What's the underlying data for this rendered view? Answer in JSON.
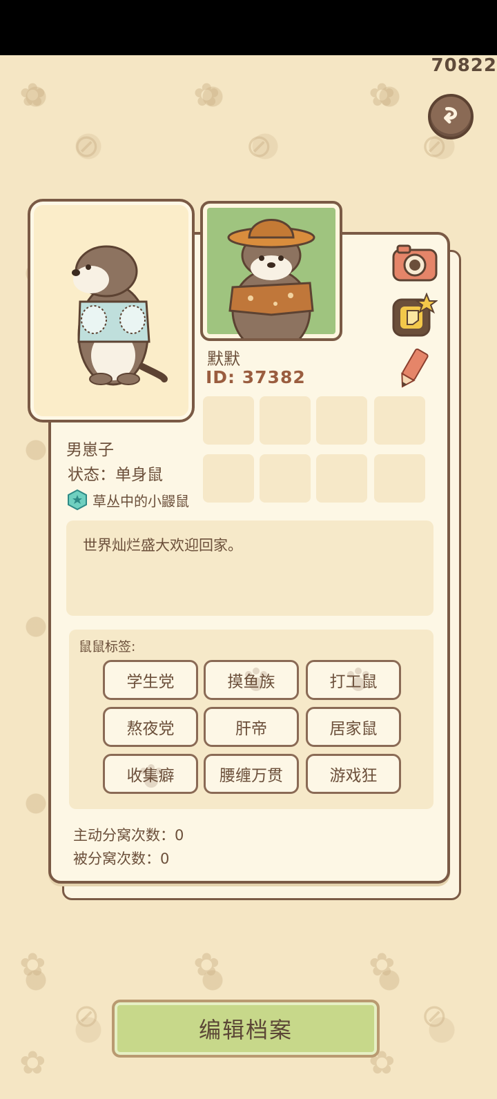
{
  "hud": {
    "score": "70822"
  },
  "profile": {
    "nickname": "默默",
    "id_text": "ID: 37382",
    "gender": "男崽子",
    "relationship_status": "状态：单身鼠",
    "title": "草丛中的小鼹鼠",
    "signature": "世界灿烂盛大欢迎回家。"
  },
  "tags": {
    "title": "鼠鼠标签:",
    "items": [
      "学生党",
      "摸鱼族",
      "打工鼠",
      "熬夜党",
      "肝帝",
      "居家鼠",
      "收集癖",
      "腰缠万贯",
      "游戏狂"
    ]
  },
  "stats": {
    "active_split": "主动分窝次数：0",
    "passive_split": "被分窝次数：0"
  },
  "actions": {
    "edit_profile": "编辑档案"
  },
  "icons": [
    "back-icon",
    "camera-icon",
    "sticker-icon",
    "pencil-icon",
    "gem-icon",
    "paw-icon"
  ],
  "colors": {
    "background": "#f5e6c4",
    "card": "#fdf7e5",
    "border": "#7a5a45",
    "edit_button": "#c7d88a",
    "id_text": "#9a5d3f"
  }
}
